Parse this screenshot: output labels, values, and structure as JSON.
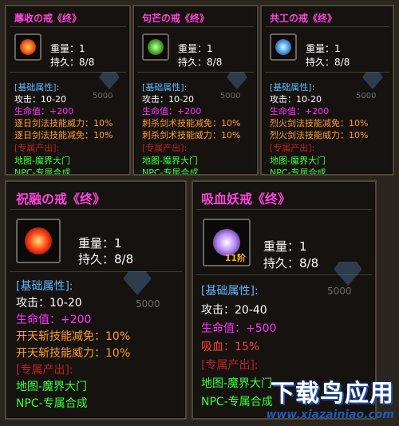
{
  "labels": {
    "weight": "重量：",
    "durability": "持久：",
    "base_attrs": "[基础属性]:",
    "attack": "攻击：",
    "hp": "生命值：",
    "exclusive": "[专属产出]:"
  },
  "cards": [
    {
      "title": "蓐收の戒《终》",
      "weight": "1",
      "durability": "8/8",
      "attack": "10-20",
      "hp": "+200",
      "bonus1": "逐日剑法技能威力：10%",
      "bonus2": "逐日剑法技能减免：10%",
      "source1": "地图-魔界大门",
      "source2": "NPC-专属合成",
      "bg_value": "5000",
      "gem_color": "#ff5a1a"
    },
    {
      "title": "句芒の戒《终》",
      "weight": "1",
      "durability": "8/8",
      "attack": "10-20",
      "hp": "+200",
      "bonus1": "刺杀剑术技能减免：10%",
      "bonus2": "刺杀剑术技能威力：10%",
      "source1": "地图-魔界大门",
      "source2": "NPC-专属合成",
      "bg_value": "5000",
      "gem_color": "#49c23a"
    },
    {
      "title": "共工の戒《终》",
      "weight": "1",
      "durability": "8/8",
      "attack": "10-20",
      "hp": "+200",
      "bonus1": "烈火剑法技能减免：10%",
      "bonus2": "烈火剑法技能威力：10%",
      "source1": "地图-魔界大门",
      "source2": "NPC-专属合成",
      "bg_value": "5000",
      "gem_color": "#4aa6ff"
    },
    {
      "title": "祝融の戒《终》",
      "weight": "1",
      "durability": "8/8",
      "attack": "10-20",
      "hp": "+200",
      "bonus1": "开天斩技能减免：10%",
      "bonus2": "开天斩技能威力：10%",
      "source1": "地图-魔界大门",
      "source2": "NPC-专属合成",
      "bg_value": "5000",
      "gem_color": "#ff3a12"
    },
    {
      "title": "吸血妖戒《终》",
      "weight": "1",
      "durability": "8/8",
      "attack": "20-40",
      "hp": "+500",
      "lifesteal_label": "吸血：",
      "lifesteal": "15%",
      "badge": "11阶",
      "source1": "地图-魔界大门",
      "source2": "NPC-专属合成",
      "bg_value": "5000",
      "gem_color": "#b98cff"
    }
  ],
  "watermark": {
    "logo": "下载鸟应用",
    "url": "www.xiazainiao.com"
  },
  "colors": {
    "title": "#ff44dd",
    "base_attr_header": "#5fb8ff",
    "hp": "#ff33ff",
    "bonus": "#ff9a2a",
    "lifesteal": "#ff3a3a",
    "exclusive_header": "#c12020",
    "source": "#39ff39"
  }
}
